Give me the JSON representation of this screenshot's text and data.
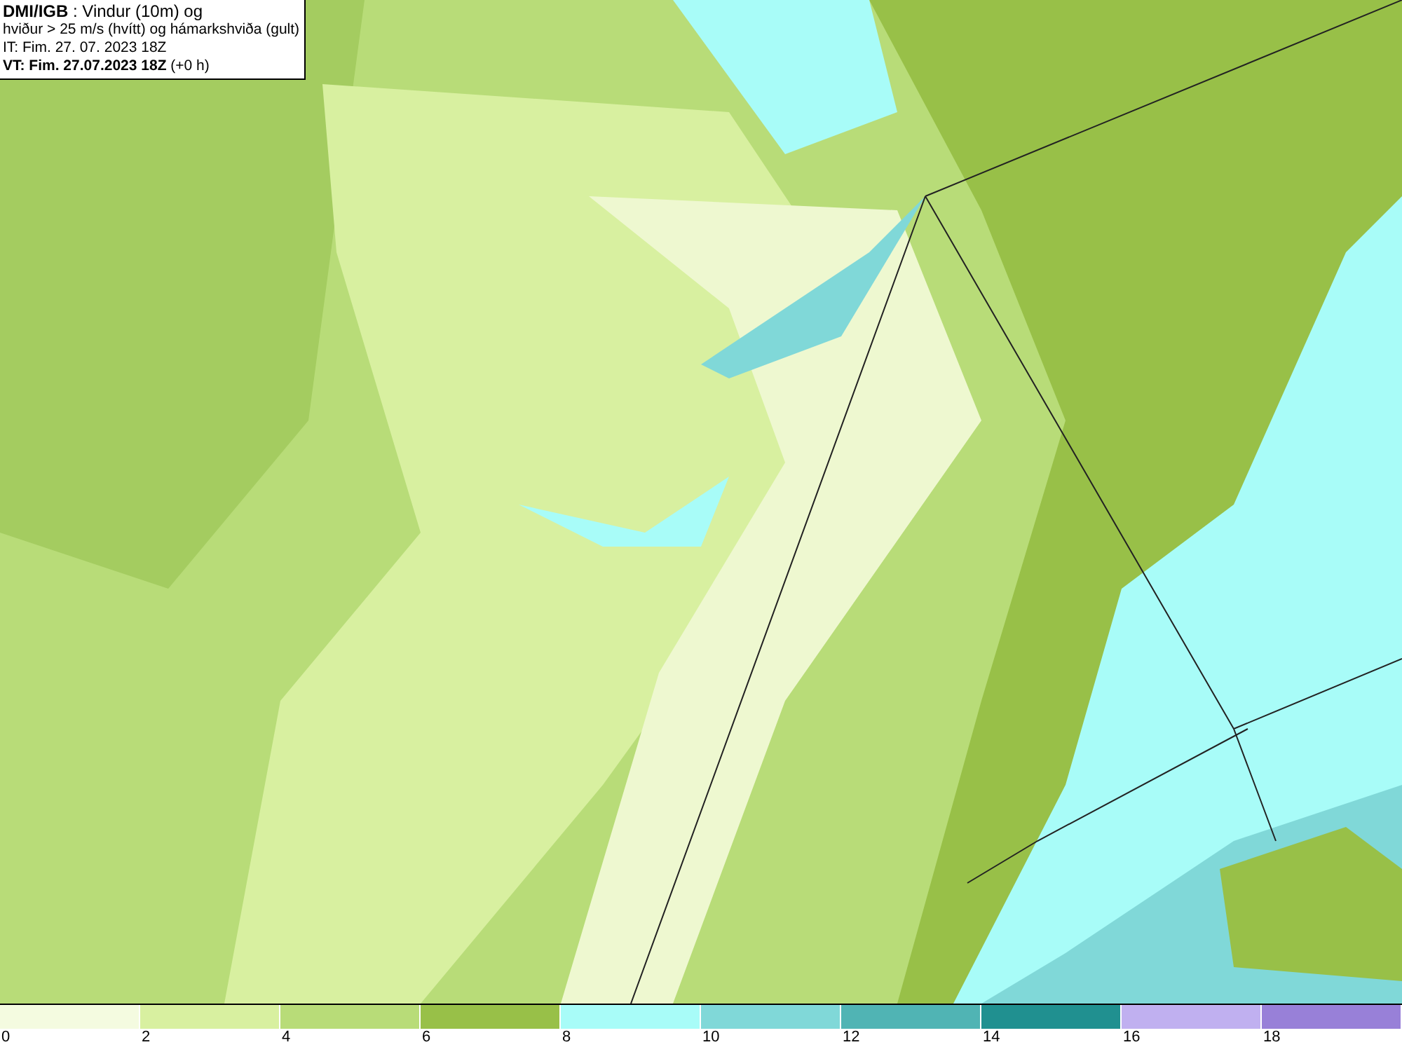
{
  "info_box": {
    "lines": [
      "**DMI/IGB** : Vindur (10m) og",
      "hviður > 25 m/s (hvítt) og hámarkshviða (gult)",
      "IT: Fim. 27. 07. 2023 18Z",
      "**VT: Fim. 27.07.2023 18Z** (+0 h)"
    ]
  },
  "legend": [
    {
      "color": "#f4fbe0",
      "label": "0"
    },
    {
      "color": "#d8f0a0",
      "label": "2"
    },
    {
      "color": "#b8dc78",
      "label": "4"
    },
    {
      "color": "#98c048",
      "label": "6"
    },
    {
      "color": "#a8fcf8",
      "label": "8"
    },
    {
      "color": "#80d8d8",
      "label": "10"
    },
    {
      "color": "#50b4b4",
      "label": "12"
    },
    {
      "color": "#209090",
      "label": "14"
    },
    {
      "color": "#c0b0f0",
      "label": "16"
    },
    {
      "color": "#9880d8",
      "label": "18"
    }
  ]
}
